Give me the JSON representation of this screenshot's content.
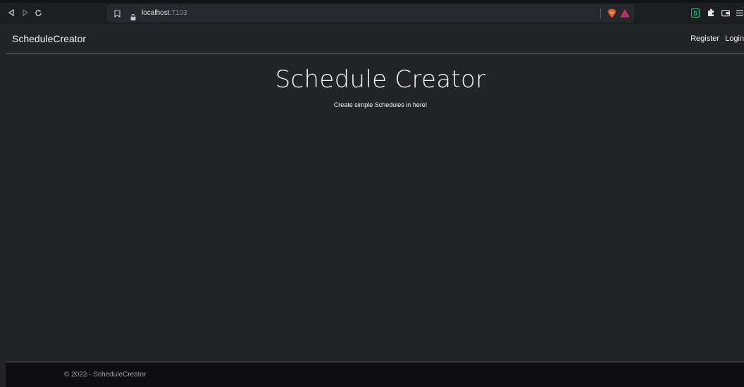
{
  "browser": {
    "url_host": "localhost",
    "url_port": ":7103"
  },
  "navbar": {
    "brand": "ScheduleCreator",
    "links": [
      {
        "label": "Register"
      },
      {
        "label": "Login"
      }
    ]
  },
  "hero": {
    "title": "Schedule Creator",
    "subtitle": "Create simple Schedules in here!"
  },
  "footer": {
    "text": "© 2022 - ScheduleCreator"
  },
  "colors": {
    "page_background": "#222428",
    "footer_background": "#0f0f11",
    "text": "#f1f2f4",
    "brave_orange": "#f25a25",
    "rewards_red": "#e2362f",
    "extension_green": "#2fb37a"
  },
  "icons": [
    "back-icon",
    "forward-icon",
    "reload-icon",
    "bookmark-icon",
    "lock-icon",
    "brave-shields-icon",
    "brave-rewards-icon",
    "extension-s-icon",
    "extensions-puzzle-icon",
    "wallet-icon",
    "menu-icon"
  ]
}
